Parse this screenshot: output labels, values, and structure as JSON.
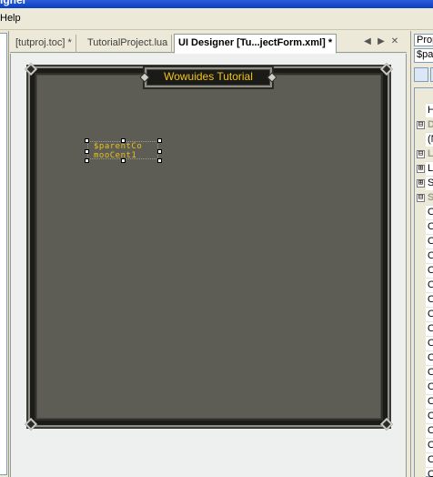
{
  "window": {
    "title": "igner"
  },
  "menubar": {
    "items": [
      "Help"
    ]
  },
  "tabs": [
    {
      "label": "[tutproj.toc] *",
      "active": false
    },
    {
      "label": "TutorialProject.lua",
      "active": false
    },
    {
      "label": "UI Designer [Tu...jectForm.xml] *",
      "active": true
    }
  ],
  "tab_controls": {
    "prev": "◀",
    "next": "▶",
    "close": "✕"
  },
  "designer": {
    "frame_title": "Wowuides Tutorial",
    "font_control_lines": [
      "$parentCo",
      "mooCent1"
    ]
  },
  "properties": {
    "title": "Prop",
    "object": "$par",
    "rows": [
      {
        "kind": "cat",
        "expander": "",
        "text": ""
      },
      {
        "kind": "prop",
        "expander": "",
        "text": "H"
      },
      {
        "kind": "cat",
        "expander": "⊟",
        "text": "D"
      },
      {
        "kind": "prop",
        "expander": "",
        "text": "(N"
      },
      {
        "kind": "cat",
        "expander": "⊟",
        "text": "L"
      },
      {
        "kind": "prop",
        "expander": "⊞",
        "text": "L"
      },
      {
        "kind": "prop",
        "expander": "⊞",
        "text": "S"
      },
      {
        "kind": "cat",
        "expander": "⊟",
        "text": "S"
      },
      {
        "kind": "prop",
        "expander": "",
        "text": "O"
      },
      {
        "kind": "prop",
        "expander": "",
        "text": "O"
      },
      {
        "kind": "prop",
        "expander": "",
        "text": "O"
      },
      {
        "kind": "prop",
        "expander": "",
        "text": "O"
      },
      {
        "kind": "prop",
        "expander": "",
        "text": "O"
      },
      {
        "kind": "prop",
        "expander": "",
        "text": "O"
      },
      {
        "kind": "prop",
        "expander": "",
        "text": "O"
      },
      {
        "kind": "prop",
        "expander": "",
        "text": "O"
      },
      {
        "kind": "prop",
        "expander": "",
        "text": "O"
      },
      {
        "kind": "prop",
        "expander": "",
        "text": "O"
      },
      {
        "kind": "prop",
        "expander": "",
        "text": "O"
      },
      {
        "kind": "prop",
        "expander": "",
        "text": "O"
      },
      {
        "kind": "prop",
        "expander": "",
        "text": "O"
      },
      {
        "kind": "prop",
        "expander": "",
        "text": "O"
      },
      {
        "kind": "prop",
        "expander": "",
        "text": "O"
      },
      {
        "kind": "prop",
        "expander": "",
        "text": "O"
      },
      {
        "kind": "prop",
        "expander": "",
        "text": "O"
      },
      {
        "kind": "prop",
        "expander": "",
        "text": "O"
      },
      {
        "kind": "prop",
        "expander": "",
        "text": "O"
      }
    ]
  },
  "colors": {
    "frame_bg": "#5d5d55",
    "frame_title_text": "#f2c418",
    "font_text": "#e8c11a"
  }
}
